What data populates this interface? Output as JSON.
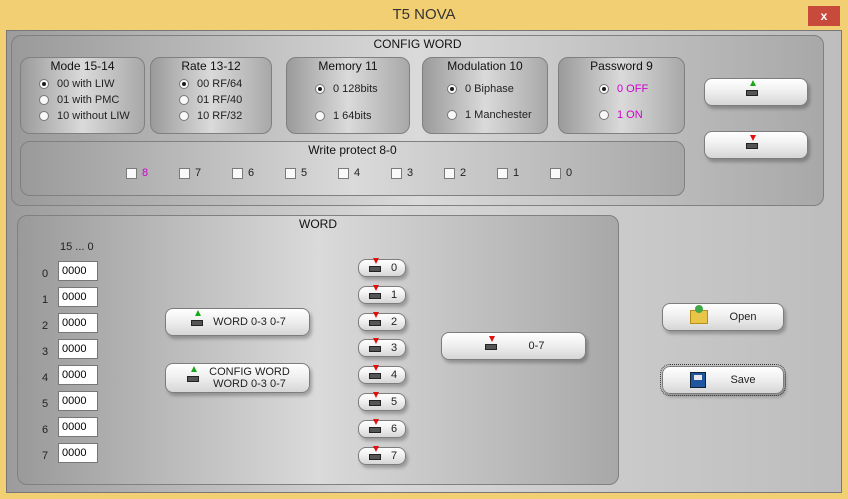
{
  "window": {
    "title": "T5 NOVA",
    "close_icon": "x"
  },
  "config_word": {
    "title": "CONFIG WORD",
    "mode": {
      "title": "Mode 15-14",
      "options": [
        "00 with LIW",
        "01 with PMC",
        "10 without LIW"
      ],
      "selected": 0
    },
    "rate": {
      "title": "Rate 13-12",
      "options": [
        "00 RF/64",
        "01 RF/40",
        "10 RF/32"
      ],
      "selected": 0
    },
    "memory": {
      "title": "Memory 11",
      "options": [
        "0 128bits",
        "1 64bits"
      ],
      "selected": 0
    },
    "modulation": {
      "title": "Modulation 10",
      "options": [
        "0 Biphase",
        "1 Manchester"
      ],
      "selected": 0
    },
    "password": {
      "title": "Password 9",
      "options": [
        "0 OFF",
        "1 ON"
      ],
      "selected": 0
    },
    "write_protect": {
      "title": "Write protect 8-0",
      "bits": [
        "8",
        "7",
        "6",
        "5",
        "4",
        "3",
        "2",
        "1",
        "0"
      ]
    }
  },
  "word": {
    "title": "WORD",
    "header": "15 ... 0",
    "rows": [
      {
        "index": "0",
        "value": "0000"
      },
      {
        "index": "1",
        "value": "0000"
      },
      {
        "index": "2",
        "value": "0000"
      },
      {
        "index": "3",
        "value": "0000"
      },
      {
        "index": "4",
        "value": "0000"
      },
      {
        "index": "5",
        "value": "0000"
      },
      {
        "index": "6",
        "value": "0000"
      },
      {
        "index": "7",
        "value": "0000"
      }
    ],
    "write_word_label": "WORD 0-3 0-7",
    "write_config_label_1": "CONFIG WORD",
    "write_config_label_2": "WORD 0-3 0-7",
    "read_buttons": [
      "0",
      "1",
      "2",
      "3",
      "4",
      "5",
      "6",
      "7"
    ],
    "read_all_label": "0-7"
  },
  "file": {
    "open_label": "Open",
    "save_label": "Save"
  },
  "colors": {
    "accent_magenta": "#d000d0"
  }
}
